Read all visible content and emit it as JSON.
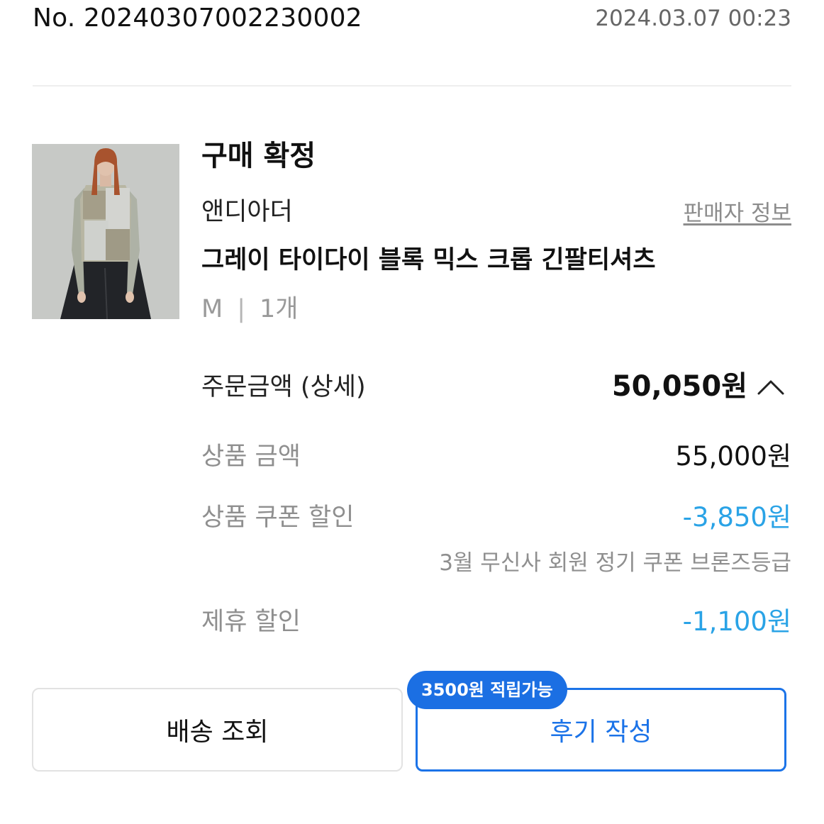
{
  "order": {
    "number": "No. 20240307002230002",
    "date": "2024.03.07 00:23"
  },
  "product": {
    "image": "product-photo",
    "status": "구매 확정",
    "brand": "앤디아더",
    "seller_info_link": "판매자 정보",
    "name": "그레이 타이다이 블록 믹스 크롭 긴팔티셔츠",
    "option_size": "M",
    "option_separator": "|",
    "option_quantity": "1개"
  },
  "price": {
    "total_label": "주문금액 (상세)",
    "total_value": "50,050원",
    "toggle_icon": "chevron-up-icon",
    "rows": [
      {
        "label": "상품 금액",
        "value": "55,000원",
        "type": "normal"
      },
      {
        "label": "상품 쿠폰 할인",
        "value": "-3,850원",
        "type": "discount",
        "note": "3월 무신사 회원 정기 쿠폰 브론즈등급"
      },
      {
        "label": "제휴 할인",
        "value": "-1,100원",
        "type": "discount"
      }
    ]
  },
  "actions": {
    "shipping_label": "배송 조회",
    "review_label": "후기 작성",
    "review_badge": "3500원 적립가능"
  },
  "colors": {
    "accent": "#1b73e8",
    "discount": "#2aa3e6",
    "muted": "#8f8f8f"
  }
}
